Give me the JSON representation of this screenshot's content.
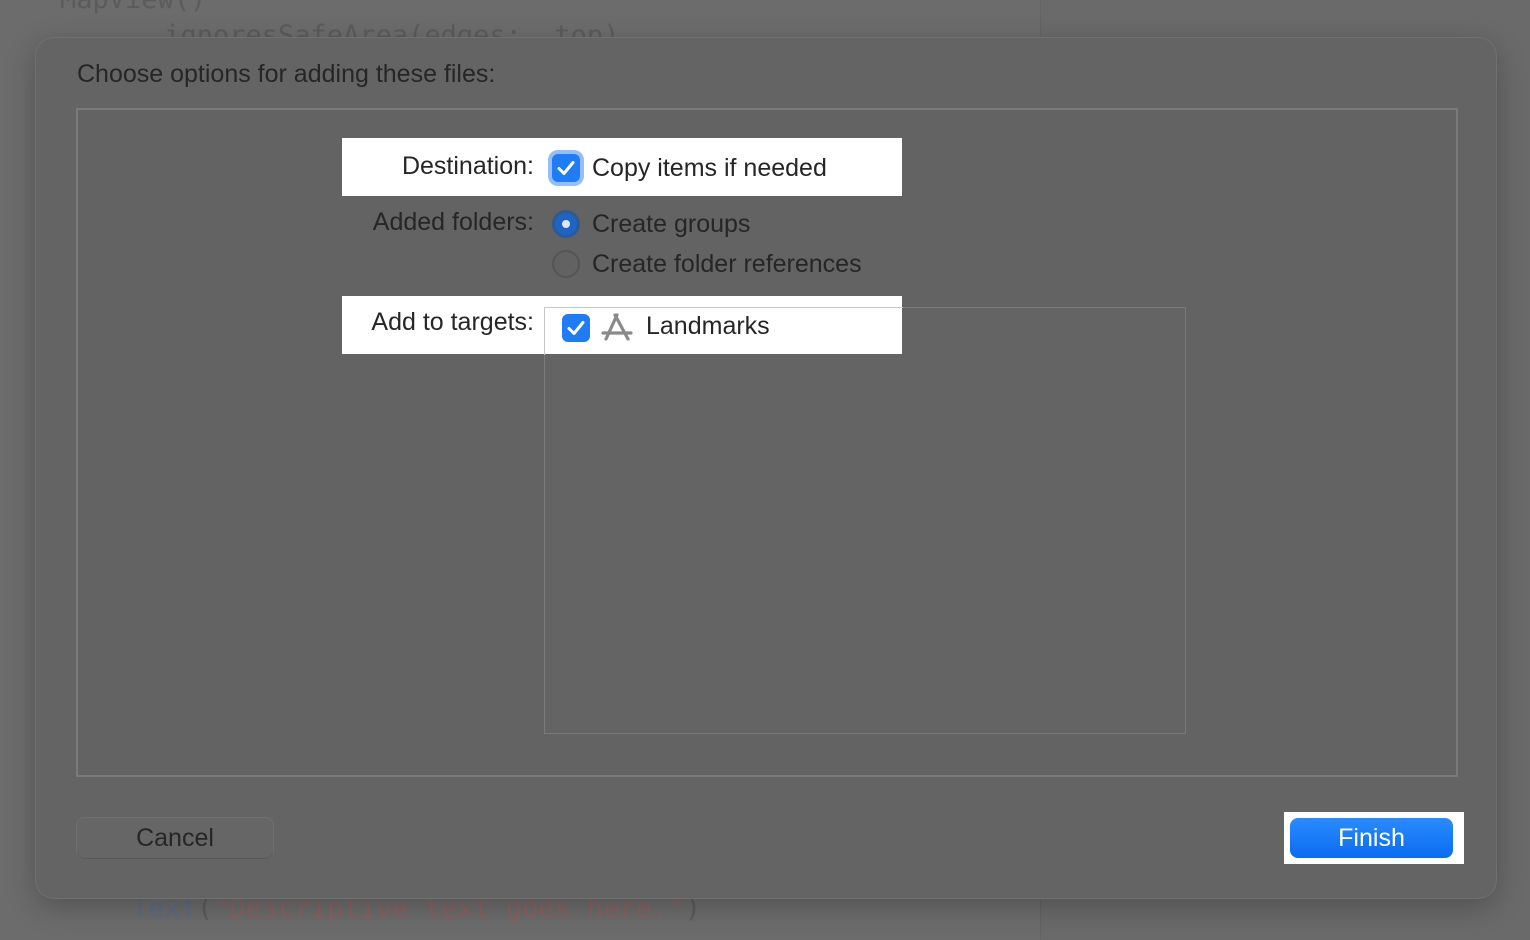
{
  "background_code": {
    "line1": "MapView()",
    "line2": ".ignoresSafeArea(edges: .top)",
    "bottom_fn": "Text",
    "bottom_open": "(",
    "bottom_str": "\"Descriptive text goes here.\"",
    "bottom_close": ")"
  },
  "dialog": {
    "title": "Choose options for adding these files:",
    "destination": {
      "label": "Destination:",
      "option_label": "Copy items if needed",
      "checked": true
    },
    "added_folders": {
      "label": "Added folders:",
      "options": [
        {
          "label": "Create groups",
          "selected": true
        },
        {
          "label": "Create folder references",
          "selected": false
        }
      ]
    },
    "targets": {
      "label": "Add to targets:",
      "items": [
        {
          "name": "Landmarks",
          "icon": "app-store-icon",
          "checked": true
        }
      ]
    },
    "buttons": {
      "cancel": "Cancel",
      "finish": "Finish"
    }
  },
  "colors": {
    "accent": "#1f7cf5",
    "highlight": "#ffffff",
    "sheet_bg": "#646464"
  }
}
